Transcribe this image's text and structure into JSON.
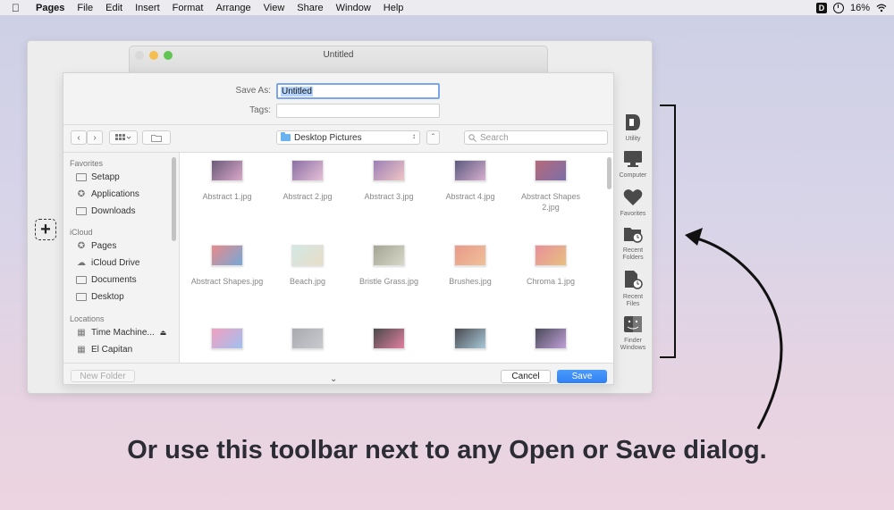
{
  "menubar": {
    "app": "Pages",
    "items": [
      "File",
      "Edit",
      "Insert",
      "Format",
      "Arrange",
      "View",
      "Share",
      "Window",
      "Help"
    ],
    "battery": "16%",
    "d_badge": "D"
  },
  "pages_window": {
    "title": "Untitled"
  },
  "dialog": {
    "save_as_label": "Save As:",
    "save_as_value": "Untitled",
    "tags_label": "Tags:",
    "location": "Desktop Pictures",
    "search_placeholder": "Search",
    "new_folder": "New Folder",
    "cancel": "Cancel",
    "save": "Save"
  },
  "sidebar": {
    "favorites_label": "Favorites",
    "favorites": [
      "Setapp",
      "Applications",
      "Downloads"
    ],
    "icloud_label": "iCloud",
    "icloud": [
      "Pages",
      "iCloud Drive",
      "Documents",
      "Desktop"
    ],
    "locations_label": "Locations",
    "locations": [
      "Time Machine...",
      "El Capitan"
    ]
  },
  "files": [
    {
      "name": "Abstract 1.jpg",
      "c1": "#6b5a7a",
      "c2": "#d9a9c9"
    },
    {
      "name": "Abstract 2.jpg",
      "c1": "#8a6fa3",
      "c2": "#e6c0d8"
    },
    {
      "name": "Abstract 3.jpg",
      "c1": "#9c80b5",
      "c2": "#efc5c5"
    },
    {
      "name": "Abstract 4.jpg",
      "c1": "#5b5a7e",
      "c2": "#d8b0d0"
    },
    {
      "name": "Abstract Shapes 2.jpg",
      "c1": "#b56a7a",
      "c2": "#7b6fa8"
    },
    {
      "name": "Abstract Shapes.jpg",
      "c1": "#e88a8a",
      "c2": "#76a8d8"
    },
    {
      "name": "Beach.jpg",
      "c1": "#d2e8e4",
      "c2": "#e8dcc8"
    },
    {
      "name": "Bristle Grass.jpg",
      "c1": "#a5a595",
      "c2": "#d8d8c8"
    },
    {
      "name": "Brushes.jpg",
      "c1": "#e89a8a",
      "c2": "#f0c098"
    },
    {
      "name": "Chroma 1.jpg",
      "c1": "#e8909a",
      "c2": "#e8c080"
    },
    {
      "name": "",
      "c1": "#f0a0c0",
      "c2": "#a0c0f0"
    },
    {
      "name": "",
      "c1": "#a8aab0",
      "c2": "#c8cace"
    },
    {
      "name": "",
      "c1": "#4a4a4a",
      "c2": "#e080a0"
    },
    {
      "name": "",
      "c1": "#4a4a50",
      "c2": "#a8c8d8"
    },
    {
      "name": "",
      "c1": "#4a4a58",
      "c2": "#c0a0d8"
    }
  ],
  "right_toolbar": [
    {
      "label": "Utility",
      "icon": "dropzone-d-icon"
    },
    {
      "label": "Computer",
      "icon": "monitor-icon"
    },
    {
      "label": "Favorites",
      "icon": "heart-icon"
    },
    {
      "label": "Recent Folders",
      "icon": "folder-clock-icon"
    },
    {
      "label": "Recent Files",
      "icon": "file-clock-icon"
    },
    {
      "label": "Finder Windows",
      "icon": "finder-icon"
    }
  ],
  "caption": "Or use this toolbar next to any Open or Save dialog."
}
